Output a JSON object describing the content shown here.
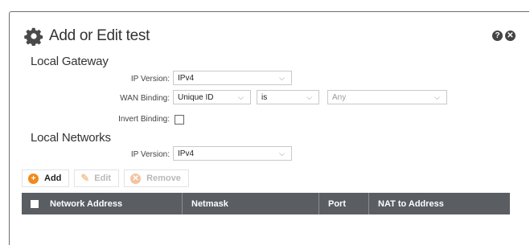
{
  "dialog": {
    "title": "Add or Edit test",
    "help_icon": "help-icon",
    "close_icon": "close-icon",
    "title_icon": "gear-icon"
  },
  "local_gateway": {
    "heading": "Local Gateway",
    "ip_version_label": "IP Version:",
    "ip_version_value": "IPv4",
    "wan_binding_label": "WAN Binding:",
    "wan_binding_type": "Unique ID",
    "wan_binding_operator": "is",
    "wan_binding_value": "Any",
    "invert_binding_label": "Invert Binding:"
  },
  "local_networks": {
    "heading": "Local Networks",
    "ip_version_label": "IP Version:",
    "ip_version_value": "IPv4",
    "toolbar": {
      "add": "Add",
      "edit": "Edit",
      "remove": "Remove"
    },
    "table": {
      "columns": [
        "Network Address",
        "Netmask",
        "Port",
        "NAT to Address"
      ]
    }
  },
  "colors": {
    "accent": "#f08a1c",
    "header_bg": "#5a5e63"
  }
}
